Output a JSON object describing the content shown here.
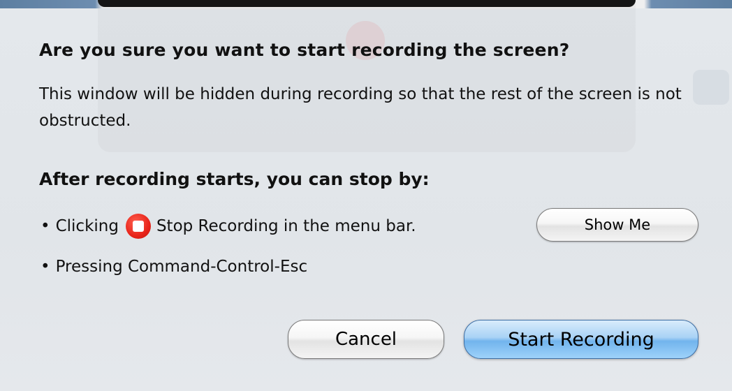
{
  "dialog": {
    "title": "Are you sure you want to start recording the screen?",
    "description": "This window will be hidden during recording so that the rest of the screen is not obstructed.",
    "subheading": "After recording starts, you can stop by:",
    "bullets": [
      {
        "prefix": "Clicking",
        "icon": "stop-recording-icon",
        "suffix": "Stop Recording in the menu bar."
      },
      {
        "text": "Pressing Command-Control-Esc"
      }
    ],
    "bullet_char": "•",
    "buttons": {
      "show_me": "Show Me",
      "cancel": "Cancel",
      "start": "Start Recording"
    }
  },
  "colors": {
    "dialog_bg": "#e2e6ea",
    "default_button": "#72b4ed",
    "stop_icon": "#e8241a"
  }
}
